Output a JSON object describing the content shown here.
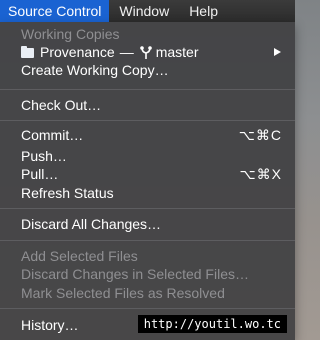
{
  "menubar": {
    "items": [
      "Source Control",
      "Window",
      "Help"
    ]
  },
  "menu": {
    "working_copies_header": "Working Copies",
    "provenance": {
      "name": "Provenance",
      "dash": "—",
      "branch": "master"
    },
    "create_working_copy": "Create Working Copy…",
    "check_out": "Check Out…",
    "commit": {
      "label": "Commit…",
      "shortcut": "⌥⌘C"
    },
    "push": "Push…",
    "pull": {
      "label": "Pull…",
      "shortcut": "⌥⌘X"
    },
    "refresh_status": "Refresh Status",
    "discard_all": "Discard All Changes…",
    "add_selected": "Add Selected Files",
    "discard_selected": "Discard Changes in Selected Files…",
    "mark_resolved": "Mark Selected Files as Resolved",
    "history": "History…"
  },
  "watermark": "http://youtil.wo.tc",
  "colors": {
    "menubar_highlight": "#1a63d2",
    "menu_background": "#3e3e40",
    "disabled_text": "#8f8f92"
  },
  "icons": [
    "folder-icon",
    "branch-icon",
    "submenu-arrow-icon"
  ]
}
